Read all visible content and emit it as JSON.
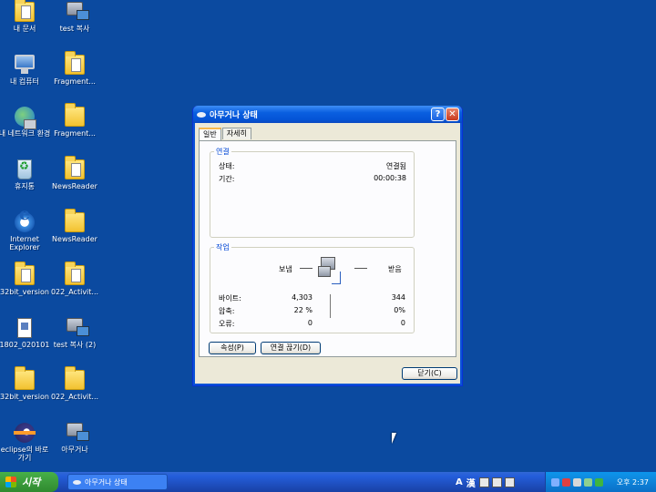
{
  "desktop": {
    "icons": [
      {
        "label": "내 문서",
        "icon": "my-documents-icon"
      },
      {
        "label": "test 복사",
        "icon": "shared-folder-icon"
      },
      {
        "label": "내 컴퓨터",
        "icon": "my-computer-icon"
      },
      {
        "label": "Fragment...",
        "icon": "folder-icon"
      },
      {
        "label": "내 네트워크 환경",
        "icon": "network-places-icon"
      },
      {
        "label": "Fragment...",
        "icon": "folder-icon"
      },
      {
        "label": "휴지통",
        "icon": "recycle-bin-icon"
      },
      {
        "label": "NewsReader",
        "icon": "folder-icon"
      },
      {
        "label": "Internet Explorer",
        "icon": "internet-explorer-icon"
      },
      {
        "label": "NewsReader",
        "icon": "folder-icon"
      },
      {
        "label": "32bit_version",
        "icon": "folder-icon"
      },
      {
        "label": "022_Activit...",
        "icon": "folder-icon"
      },
      {
        "label": "1802_020101",
        "icon": "file-icon"
      },
      {
        "label": "test 복사 (2)",
        "icon": "shared-folder-icon"
      },
      {
        "label": "32bit_version",
        "icon": "folder-icon"
      },
      {
        "label": "022_Activit...",
        "icon": "folder-icon"
      },
      {
        "label": "eclipse의 바로 가기",
        "icon": "eclipse-icon"
      },
      {
        "label": "아무거나",
        "icon": "network-connection-icon"
      }
    ]
  },
  "dialog": {
    "title": "아무거나 상태",
    "help_label": "?",
    "close_label": "✕",
    "tabs": [
      {
        "label": "일반",
        "active": true
      },
      {
        "label": "자세히",
        "active": false
      }
    ],
    "connection": {
      "group_title": "연결",
      "status_label": "상태:",
      "status_value": "연결됨",
      "duration_label": "기간:",
      "duration_value": "00:00:38"
    },
    "activity": {
      "group_title": "작업",
      "sent_label": "보냄",
      "received_label": "받음",
      "bytes_label": "바이트:",
      "bytes_sent": "4,303",
      "bytes_received": "344",
      "compression_label": "압축:",
      "compression_sent": "22 %",
      "compression_received": "0%",
      "errors_label": "오류:",
      "errors_sent": "0",
      "errors_received": "0"
    },
    "properties_button": "속성(P)",
    "disconnect_button": "연결 끊기(D)",
    "close_button": "닫기(C)"
  },
  "taskbar": {
    "start_label": "시작",
    "task_label": "아무거나 상태",
    "lang_a": "A",
    "lang_hanja": "漢",
    "clock": "오후 2:37"
  },
  "colors": {
    "desktop": "#0b4aa0",
    "titlebar": "#0a5fe0",
    "group_title": "#0046d5",
    "start_button": "#3c9c3c"
  }
}
